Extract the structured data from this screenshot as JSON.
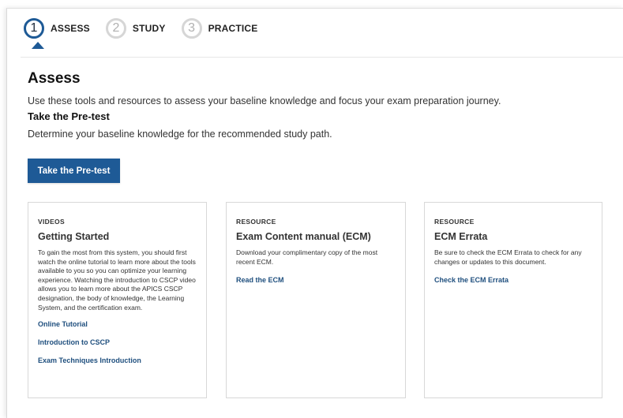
{
  "stepper": {
    "steps": [
      {
        "number": "1",
        "label": "ASSESS",
        "state": "active"
      },
      {
        "number": "2",
        "label": "STUDY",
        "state": "inactive"
      },
      {
        "number": "3",
        "label": "PRACTICE",
        "state": "inactive"
      }
    ]
  },
  "main": {
    "title": "Assess",
    "intro": "Use these tools and resources to assess your baseline knowledge and focus your exam preparation journey.",
    "pretest_heading": "Take the Pre-test",
    "pretest_text": "Determine your baseline knowledge for the recommended study path.",
    "pretest_button": "Take the Pre-test"
  },
  "cards": [
    {
      "kicker": "VIDEOS",
      "title": "Getting Started",
      "text": "To gain the most from this system, you should first watch the online tutorial to learn more about the tools available to you so you can optimize your learning experience. Watching the introduction to CSCP video allows you to learn more about the APICS CSCP designation, the body of knowledge, the Learning System, and the certification exam.",
      "links": [
        "Online Tutorial",
        "Introduction to CSCP",
        "Exam Techniques Introduction"
      ]
    },
    {
      "kicker": "RESOURCE",
      "title": "Exam Content manual (ECM)",
      "text": "Download your complimentary copy of the most recent ECM.",
      "links": [
        "Read the ECM"
      ]
    },
    {
      "kicker": "RESOURCE",
      "title": "ECM Errata",
      "text": "Be sure to check the ECM Errata to check for any changes or updates to this document.",
      "links": [
        "Check the ECM Errata"
      ]
    }
  ],
  "colors": {
    "accent": "#1e5a96",
    "link": "#1f4f7e",
    "inactive_step": "#d6d6d6"
  }
}
